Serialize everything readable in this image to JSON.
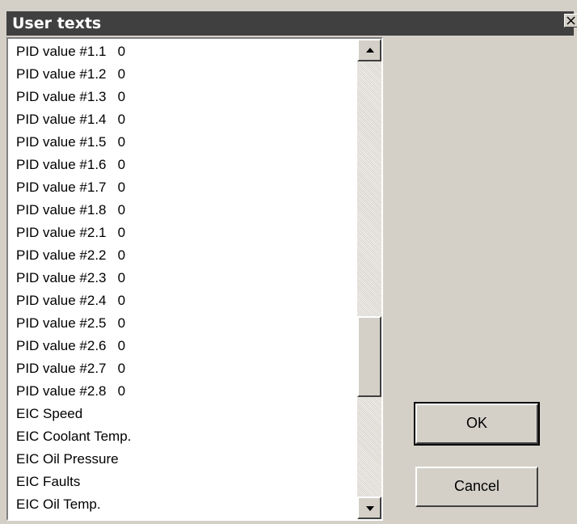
{
  "dialog": {
    "title": "User texts"
  },
  "list": {
    "items": [
      "PID value #1.1   0",
      "PID value #1.2   0",
      "PID value #1.3   0",
      "PID value #1.4   0",
      "PID value #1.5   0",
      "PID value #1.6   0",
      "PID value #1.7   0",
      "PID value #1.8   0",
      "PID value #2.1   0",
      "PID value #2.2   0",
      "PID value #2.3   0",
      "PID value #2.4   0",
      "PID value #2.5   0",
      "PID value #2.6   0",
      "PID value #2.7   0",
      "PID value #2.8   0",
      "EIC Speed",
      "EIC Coolant Temp.",
      "EIC Oil Pressure",
      "EIC Faults",
      "EIC Oil Temp."
    ]
  },
  "buttons": {
    "ok_label": "OK",
    "cancel_label": "Cancel"
  },
  "icons": {
    "close": "close-icon",
    "scroll_up": "arrow-up-icon",
    "scroll_down": "arrow-down-icon"
  },
  "colors": {
    "titlebar": "#404040",
    "dialog_bg": "#d4d0c8",
    "list_bg": "#ffffff"
  }
}
